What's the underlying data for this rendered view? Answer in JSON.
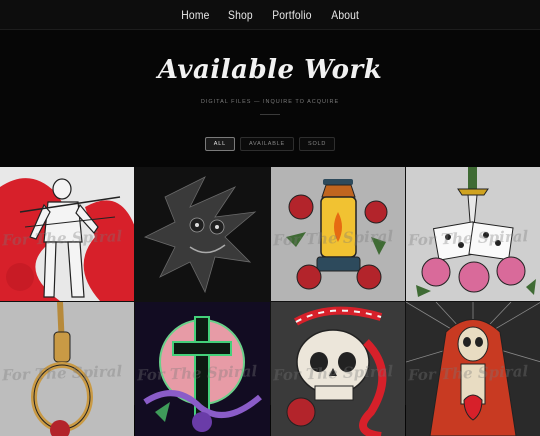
{
  "nav": {
    "items": [
      "Home",
      "Shop",
      "Portfolio",
      "About"
    ]
  },
  "header": {
    "title": "Available Work",
    "subtitle": "DIGITAL FILES — INQUIRE TO ACQUIRE"
  },
  "filters": {
    "items": [
      "ALL",
      "AVAILABLE",
      "SOLD"
    ],
    "active": "ALL"
  },
  "gallery": {
    "watermark": "For The Spiral",
    "items": [
      {
        "subject": "armored-knight",
        "bg": "#d7202a"
      },
      {
        "subject": "dark-hedgehog",
        "bg": "#151515"
      },
      {
        "subject": "lantern-roses",
        "bg": "#a9a9a9"
      },
      {
        "subject": "dagger-dice-roses",
        "bg": "#c9c9c9"
      },
      {
        "subject": "noose",
        "bg": "#bdbdbd"
      },
      {
        "subject": "cross-orb",
        "bg": "#1b1430"
      },
      {
        "subject": "skull-snake",
        "bg": "#3c3c3c"
      },
      {
        "subject": "reaper-heart",
        "bg": "#2a2a2a"
      }
    ]
  },
  "colors": {
    "background": "#060606",
    "nav_text": "#e8e8e8",
    "accent_red": "#d7202a"
  }
}
